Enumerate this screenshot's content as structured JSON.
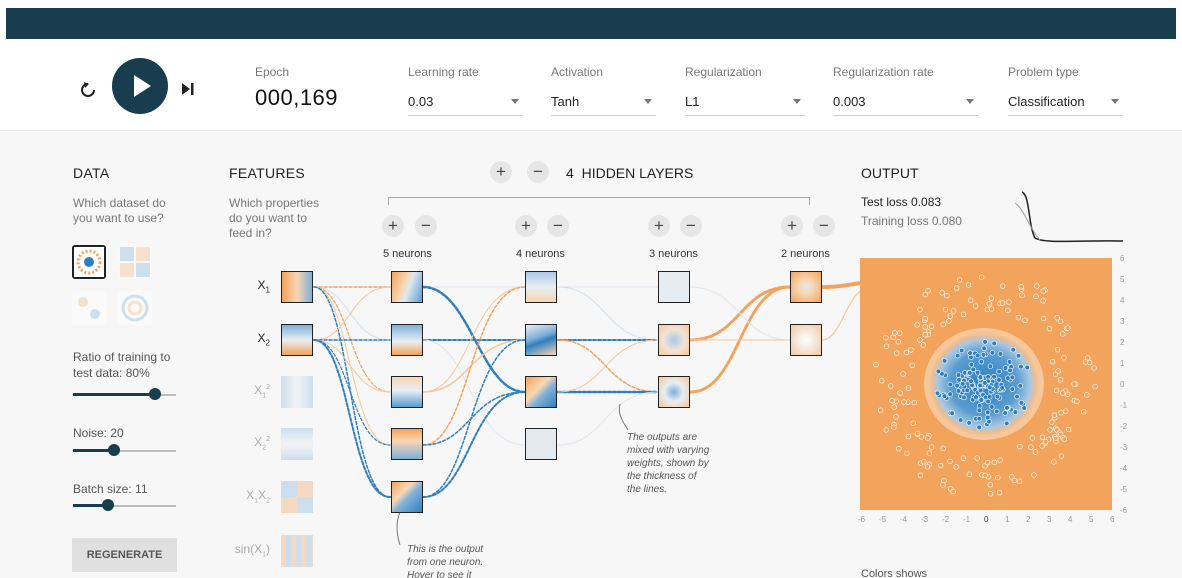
{
  "controls": {
    "epoch_label": "Epoch",
    "epoch_value": "000,169",
    "learning_rate_label": "Learning rate",
    "learning_rate_value": "0.03",
    "activation_label": "Activation",
    "activation_value": "Tanh",
    "regularization_label": "Regularization",
    "regularization_value": "L1",
    "regularization_rate_label": "Regularization rate",
    "regularization_rate_value": "0.003",
    "problem_type_label": "Problem type",
    "problem_type_value": "Classification"
  },
  "data_panel": {
    "title": "DATA",
    "description_line1": "Which dataset do",
    "description_line2": "you want to use?",
    "ratio_label_line1": "Ratio of training to",
    "ratio_label_line2": "test data:",
    "ratio_value": "80%",
    "ratio_fraction": 0.8,
    "noise_label": "Noise:",
    "noise_value": "20",
    "noise_fraction": 0.4,
    "batch_label": "Batch size:",
    "batch_value": "11",
    "batch_fraction": 0.34,
    "regenerate_label": "REGENERATE"
  },
  "features_panel": {
    "title": "FEATURES",
    "description_line1": "Which properties",
    "description_line2": "do you want to",
    "description_line3": "feed in?",
    "features": [
      {
        "base": "X",
        "sub": "1",
        "active": true
      },
      {
        "base": "X",
        "sub": "2",
        "active": true
      },
      {
        "base": "X",
        "sub": "1",
        "sup": "2",
        "active": false
      },
      {
        "base": "X",
        "sub": "2",
        "sup": "2",
        "active": false
      },
      {
        "base": "X",
        "sub": "1",
        "base2": "X",
        "sub2": "2",
        "active": false
      },
      {
        "base": "sin(X",
        "sub": "1",
        "tail": ")",
        "active": false
      }
    ]
  },
  "network": {
    "plus_label": "+",
    "minus_label": "−",
    "hidden_layers_count": "4",
    "hidden_layers_label": "HIDDEN LAYERS",
    "layers": [
      {
        "neurons_label": "5 neurons"
      },
      {
        "neurons_label": "4 neurons"
      },
      {
        "neurons_label": "3 neurons"
      },
      {
        "neurons_label": "2 neurons"
      }
    ],
    "annotation_outputs": [
      "The outputs are",
      "mixed with varying",
      "weights, shown by",
      "the thickness of",
      "the lines."
    ],
    "annotation_neuron": [
      "This is the output",
      "from one neuron.",
      "Hover to see it"
    ]
  },
  "output_panel": {
    "title": "OUTPUT",
    "test_loss_label": "Test loss 0.083",
    "training_loss_label": "Training loss 0.080",
    "y_ticks": [
      "6",
      "5",
      "4",
      "3",
      "2",
      "1",
      "0",
      "-1",
      "-2",
      "-3",
      "-4",
      "-5",
      "-6"
    ],
    "x_ticks": [
      "-6",
      "-5",
      "-4",
      "-3",
      "-2",
      "-1",
      "0",
      "1",
      "2",
      "3",
      "4",
      "5",
      "6"
    ],
    "colors_label": "Colors shows"
  },
  "colors": {
    "orange": "#f2a45c",
    "blue": "#2f7fc0",
    "dark": "#183d4e"
  }
}
